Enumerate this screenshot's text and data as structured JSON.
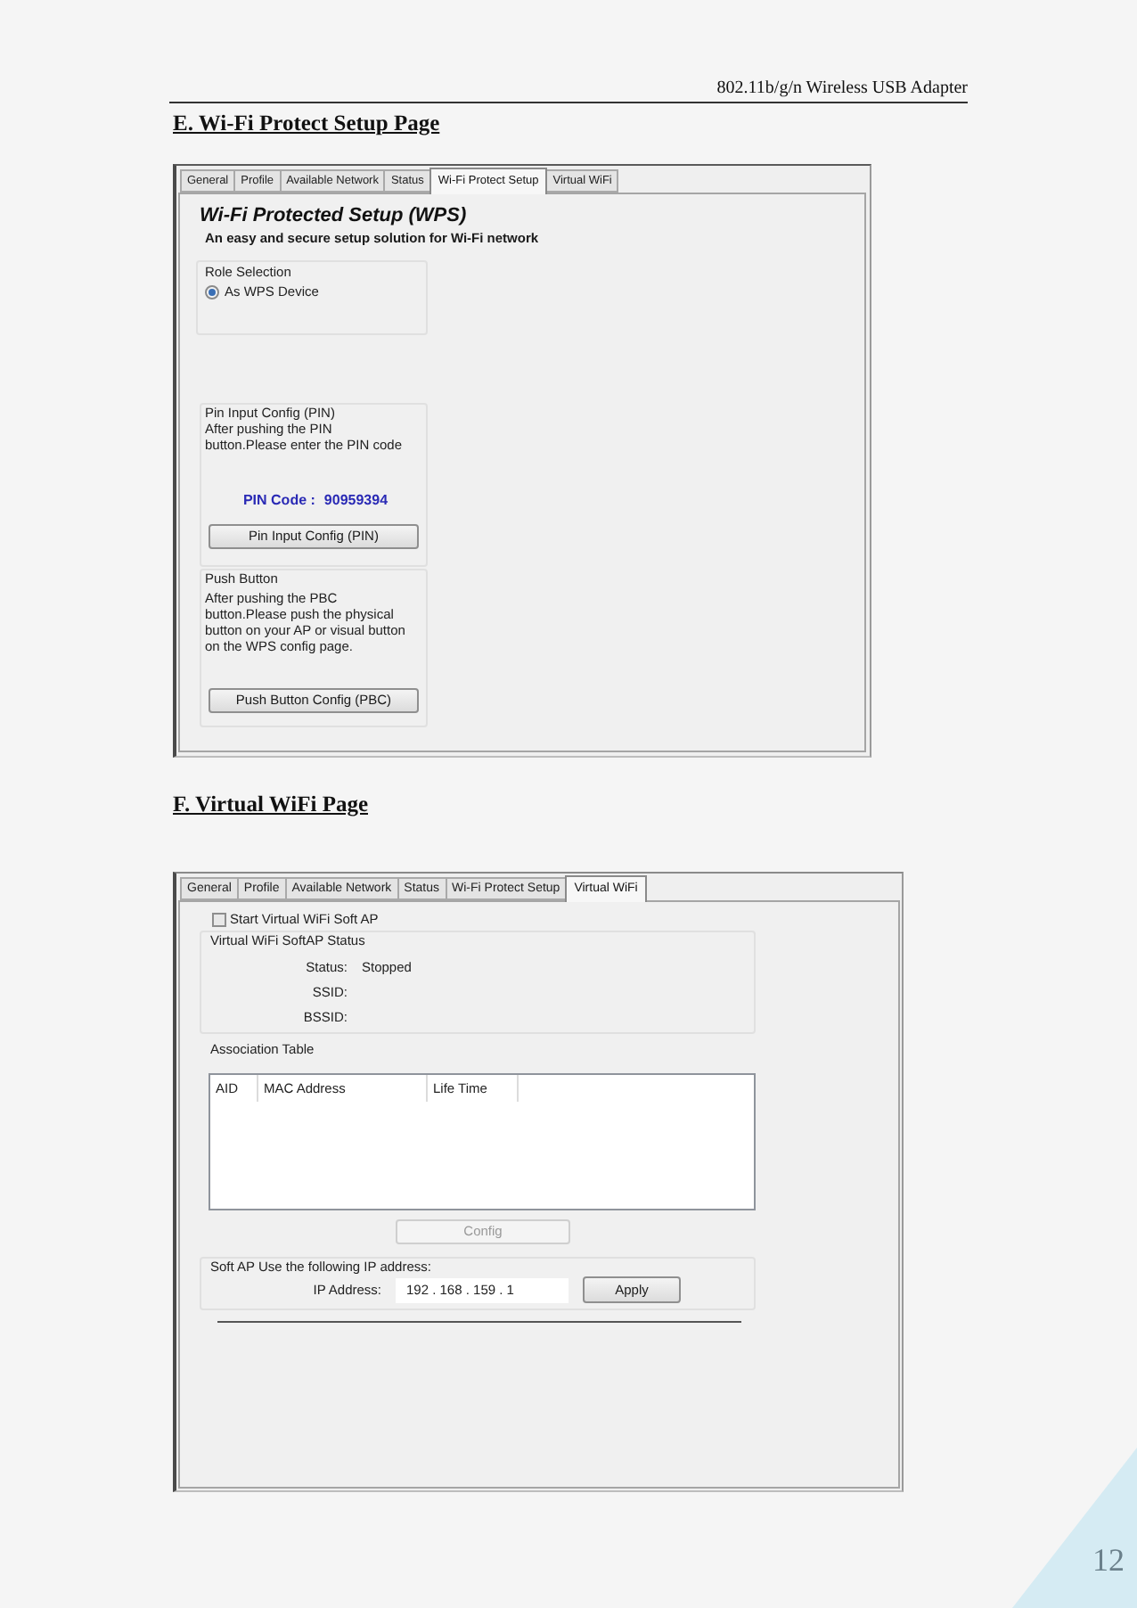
{
  "running_header": {
    "title": "802.11b/g/n Wireless USB Adapter"
  },
  "wps_section": {
    "heading": "E. Wi-Fi Protect Setup Page",
    "tabs": [
      {
        "label": "General",
        "selected": false
      },
      {
        "label": "Profile",
        "selected": false
      },
      {
        "label": "Available Network",
        "selected": false
      },
      {
        "label": "Status",
        "selected": false
      },
      {
        "label": "Wi-Fi Protect Setup",
        "selected": true
      },
      {
        "label": "Virtual WiFi",
        "selected": false
      }
    ],
    "title": "Wi-Fi Protected Setup (WPS)",
    "subtitle": "An easy and secure setup solution for Wi-Fi network",
    "role_group": {
      "label": "Role Selection",
      "options": [
        {
          "label": "As WPS Device",
          "selected": true
        }
      ]
    },
    "pin_group": {
      "label": "Pin Input Config (PIN)",
      "description": "After pushing the PIN\nbutton.Please enter the PIN code",
      "pin_label": "PIN Code :",
      "pin_value": "90959394",
      "button": "Pin Input Config (PIN)"
    },
    "push_group": {
      "label": "Push Button",
      "description": "After pushing the PBC\nbutton.Please push the physical\nbutton on your AP or visual button\non the WPS config page.",
      "button": "Push Button Config (PBC)"
    }
  },
  "virtual_wifi_section": {
    "heading": "F. Virtual WiFi Page",
    "tabs": [
      {
        "label": "General",
        "selected": false
      },
      {
        "label": "Profile",
        "selected": false
      },
      {
        "label": "Available Network",
        "selected": false
      },
      {
        "label": "Status",
        "selected": false
      },
      {
        "label": "Wi-Fi Protect Setup",
        "selected": false
      },
      {
        "label": "Virtual WiFi",
        "selected": true
      }
    ],
    "start_checkbox": {
      "label": "Start Virtual WiFi Soft AP",
      "checked": false
    },
    "status_group": {
      "label": "Virtual WiFi SoftAP Status",
      "fields": [
        {
          "label": "Status:",
          "value": "Stopped"
        },
        {
          "label": "SSID:"
        },
        {
          "label": "BSSID:"
        }
      ]
    },
    "association_table": {
      "label": "Association Table",
      "columns": [
        "AID",
        "MAC Address",
        "Life Time"
      ]
    },
    "config_button": {
      "label": "Config",
      "disabled": true
    },
    "ip_group": {
      "label": "Soft AP Use the following IP address:",
      "field_label": "IP Address:",
      "value": "192 . 168 . 159 . 1",
      "button": "Apply"
    }
  },
  "page_number": "12"
}
